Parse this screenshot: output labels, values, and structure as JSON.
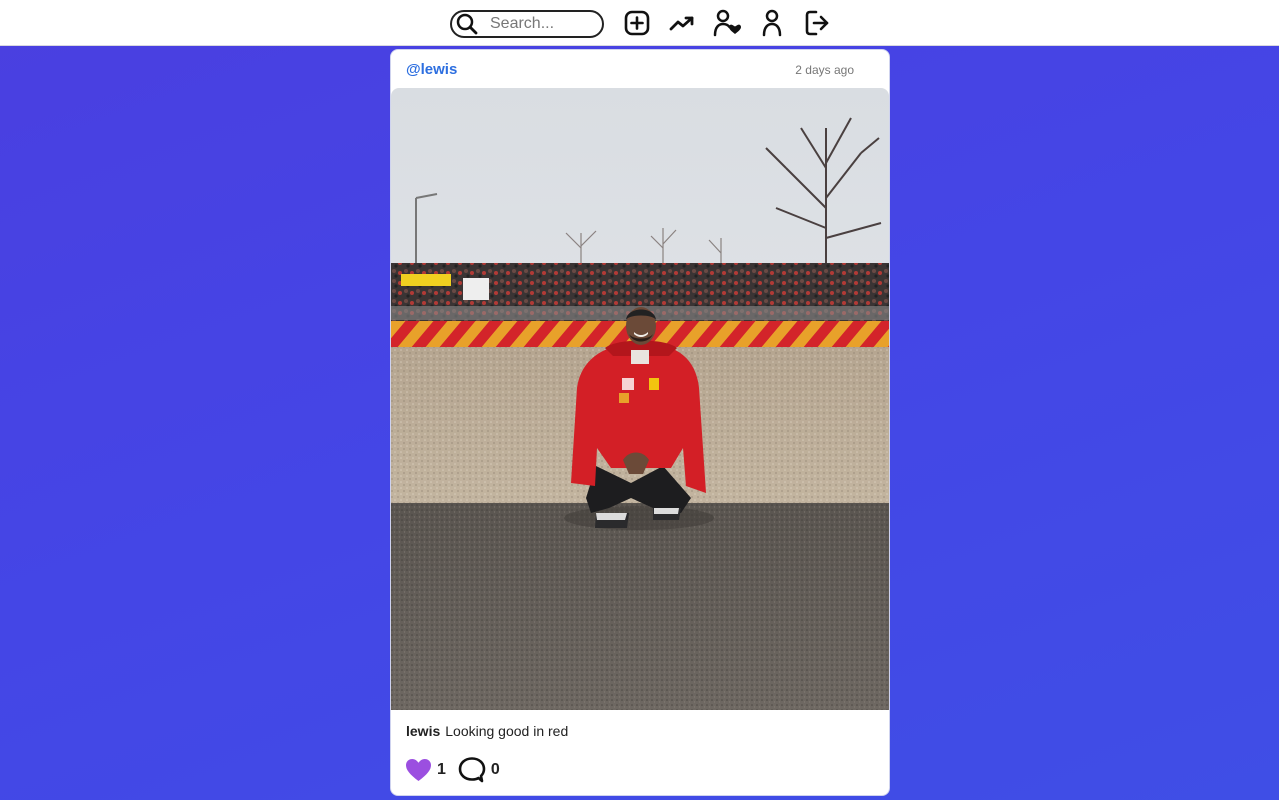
{
  "topbar": {
    "search": {
      "placeholder": "Search...",
      "value": ""
    },
    "nav": [
      {
        "icon": "add-post-icon"
      },
      {
        "icon": "trending-icon"
      },
      {
        "icon": "following-icon"
      },
      {
        "icon": "profile-icon"
      },
      {
        "icon": "logout-icon"
      }
    ]
  },
  "post": {
    "handle": "@lewis",
    "time_ago": "2 days ago",
    "image": {
      "subject": "person crouching on gravel trackside in red jacket"
    },
    "caption_user": "lewis",
    "caption_text": "Looking good in red",
    "likes": "1",
    "comments": "0",
    "like_color": "#9b4fe0"
  },
  "colors": {
    "accent_link": "#2d6fe0",
    "background": "#4446e6"
  }
}
